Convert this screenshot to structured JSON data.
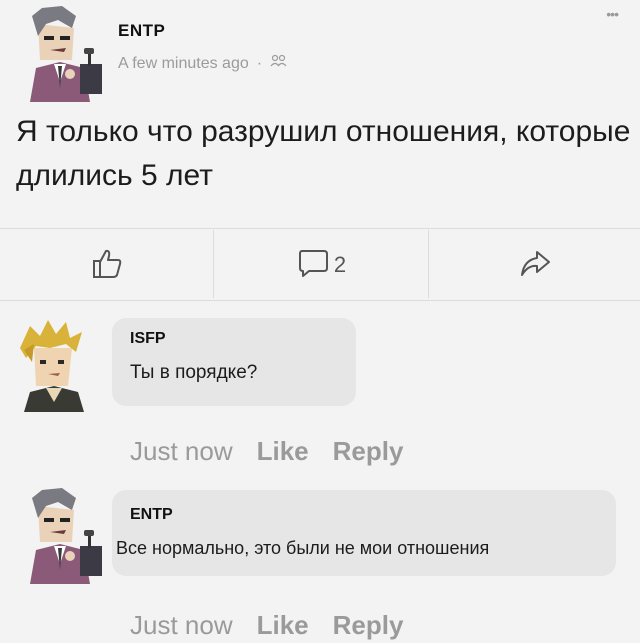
{
  "post": {
    "author": "ENTP",
    "time": "A few minutes ago",
    "separator": "·",
    "audience_icon": "friends-icon",
    "more_label": "•••",
    "text": "Я только что разрушил отношения, которые длились 5 лет"
  },
  "actions": {
    "like_icon": "thumbs-up-icon",
    "comment_icon": "comment-icon",
    "comment_count": "2",
    "share_icon": "share-icon"
  },
  "comments": [
    {
      "author": "ISFP",
      "text": "Ты в порядке?",
      "time": "Just now",
      "like_label": "Like",
      "reply_label": "Reply"
    },
    {
      "author": "ENTP",
      "text": "Все нормально, это были не мои отношения",
      "time": "Just now",
      "like_label": "Like",
      "reply_label": "Reply"
    }
  ]
}
